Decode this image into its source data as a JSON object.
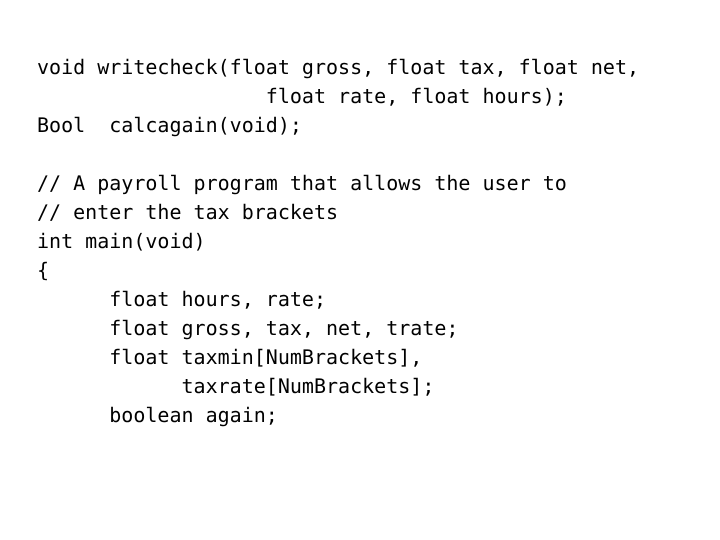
{
  "slide": {
    "background_color": "#ffffff",
    "text_color": "#000000",
    "language": "c"
  },
  "code": {
    "lines": [
      "void writecheck(float gross, float tax, float net,",
      "                   float rate, float hours);",
      "Bool  calcagain(void);",
      "",
      "// A payroll program that allows the user to",
      "// enter the tax brackets",
      "int main(void)",
      "{",
      "      float hours, rate;",
      "      float gross, tax, net, trate;",
      "      float taxmin[NumBrackets],",
      "            taxrate[NumBrackets];",
      "      boolean again;"
    ]
  }
}
